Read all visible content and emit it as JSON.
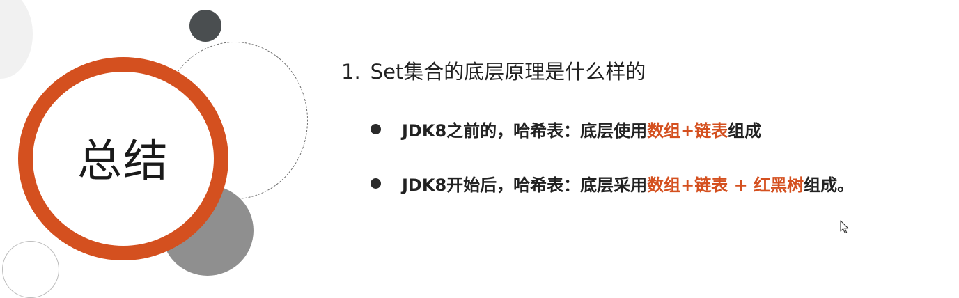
{
  "slide": {
    "badge_title": "总结",
    "heading": {
      "number": "1.",
      "text": "Set集合的底层原理是什么样的"
    },
    "bullets": [
      {
        "prefix": "JDK8之前的，哈希表：底层使用",
        "highlight": "数组+链表",
        "suffix": "组成"
      },
      {
        "prefix": "JDK8开始后，哈希表：底层采用",
        "highlight": "数组+链表 + 红黑树",
        "suffix": "组成。"
      }
    ]
  },
  "colors": {
    "accent": "#d4501f",
    "text": "#222222",
    "dark_circle": "#4a4e50",
    "gray_circle": "#8f8f8f"
  },
  "icons": {
    "cursor": "mouse-pointer-icon"
  }
}
